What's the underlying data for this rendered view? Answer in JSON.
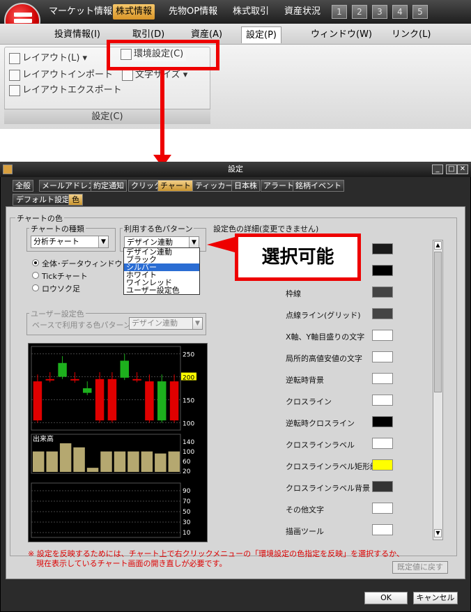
{
  "app_menu": [
    "マーケット情報",
    "株式情報",
    "先物OP情報",
    "株式取引",
    "資産状況"
  ],
  "app_menu_active": "株式情報",
  "num_buttons": [
    "1",
    "2",
    "3",
    "4",
    "5"
  ],
  "ribbon_tabs": [
    "投資情報(I)",
    "取引(D)",
    "資産(A)",
    "設定(P)",
    "ウィンドウ(W)",
    "リンク(L)"
  ],
  "ribbon_active_tab": "設定(P)",
  "ribbon": {
    "layout": "レイアウト(L) ▾",
    "layout_import": "レイアウトインポート",
    "layout_export": "レイアウトエクスポート",
    "env_settings": "環境設定(C)",
    "font_size": "文字サイズ ▾",
    "group_label": "設定(C)"
  },
  "dialog": {
    "title": "設定",
    "tabs": [
      "全般",
      "メールアドレス",
      "約定通知",
      "クリック",
      "チャート",
      "ティッカー",
      "日本株",
      "アラート",
      "銘柄イベント"
    ],
    "active_tab": "チャート",
    "subtabs": [
      "デフォルト設定",
      "色"
    ],
    "active_subtab": "色",
    "group_title": "チャートの色",
    "chart_type_label": "チャートの種類",
    "chart_type_value": "分析チャート",
    "pattern_label": "利用する色パターン",
    "pattern_value": "デザイン連動",
    "pattern_options": [
      "デザイン連動",
      "ブラック",
      "シルバー",
      "ホワイト",
      "ワインレッド",
      "ユーザー設定色"
    ],
    "pattern_selected": "シルバー",
    "radios": [
      "全体･データウィンドウ",
      "Tickチャート",
      "ロウソク足"
    ],
    "radio_selected": 0,
    "user_color_label": "ユーザー設定色",
    "base_pattern_label": "ベースで利用する色パターン",
    "base_pattern_value": "デザイン連動",
    "details_label": "設定色の詳細(変更できません)",
    "callout": "選択可能",
    "chart_yticks": [
      "250",
      "200",
      "150",
      "100"
    ],
    "chart_highlight_tick": "200",
    "volume_label": "出来高",
    "volume_ticks": [
      "140",
      "100",
      "60",
      "20"
    ],
    "sub_ticks": [
      "90",
      "70",
      "50",
      "30",
      "10"
    ],
    "color_items": [
      {
        "label": "",
        "color": "#1a1a1a"
      },
      {
        "label": "",
        "color": "#000000"
      },
      {
        "label": "枠線",
        "color": "#444444"
      },
      {
        "label": "点線ライン(グリッド)",
        "color": "#444444"
      },
      {
        "label": "X軸、Y軸目盛りの文字",
        "color": "#ffffff"
      },
      {
        "label": "局所的高値安値の文字",
        "color": "#ffffff"
      },
      {
        "label": "逆転時背景",
        "color": "#ffffff"
      },
      {
        "label": "クロスライン",
        "color": "#ffffff"
      },
      {
        "label": "逆転時クロスライン",
        "color": "#000000"
      },
      {
        "label": "クロスラインラベル",
        "color": "#ffffff"
      },
      {
        "label": "クロスラインラベル矩形線",
        "color": "#ffff00"
      },
      {
        "label": "クロスラインラベル背景",
        "color": "#333333"
      },
      {
        "label": "その他文字",
        "color": "#ffffff"
      },
      {
        "label": "描画ツール",
        "color": "#ffffff"
      }
    ],
    "note_line1": "※ 設定を反映するためには、チャート上で右クリックメニューの「環境設定の色指定を反映」を選択するか、",
    "note_line2": "現在表示しているチャート画面の開き直しが必要です。",
    "reset_button": "既定値に戻す",
    "ok_button": "OK",
    "cancel_button": "キャンセル"
  },
  "chart_data": {
    "type": "candlestick",
    "y_ticks": [
      250,
      200,
      150,
      100
    ],
    "candles": [
      {
        "open": 190,
        "close": 105,
        "up": false
      },
      {
        "open": 195,
        "close": 193,
        "up": false
      },
      {
        "open": 200,
        "close": 230,
        "up": true
      },
      {
        "open": 195,
        "close": 192,
        "up": false
      },
      {
        "open": 165,
        "close": 175,
        "up": true
      },
      {
        "open": 195,
        "close": 105,
        "up": false
      },
      {
        "open": 195,
        "close": 105,
        "up": false
      },
      {
        "open": 198,
        "close": 235,
        "up": true
      },
      {
        "open": 195,
        "close": 193,
        "up": false
      },
      {
        "open": 190,
        "close": 105,
        "up": false
      },
      {
        "open": 190,
        "close": 105,
        "up": true
      },
      {
        "open": 190,
        "close": 105,
        "up": false
      }
    ],
    "volume": [
      100,
      100,
      140,
      120,
      20,
      100,
      100,
      100,
      100,
      90,
      100
    ]
  }
}
